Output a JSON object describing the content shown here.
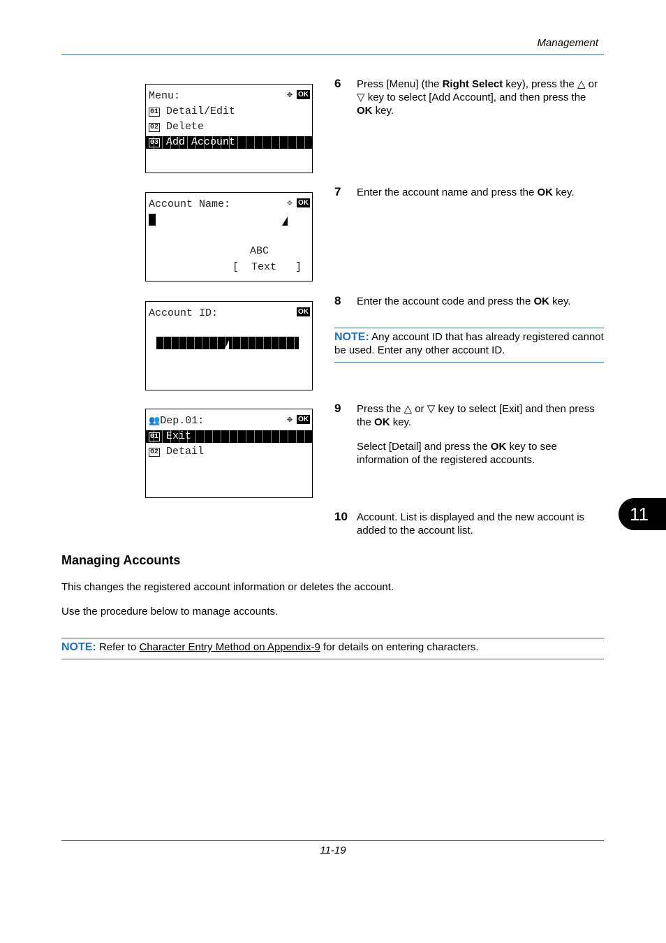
{
  "header": {
    "section": "Management"
  },
  "panels": [
    {
      "title": "Menu:",
      "nav_icon": "four-way-arrow",
      "ok": "OK",
      "items": [
        {
          "num": "01",
          "label": "Detail/Edit"
        },
        {
          "num": "02",
          "label": "Delete"
        },
        {
          "num": "03",
          "label": "Add Account",
          "selected": true
        }
      ]
    },
    {
      "title": "Account Name:",
      "nav_icon": "four-way-arrow-dotted",
      "ok": "OK",
      "mode": "ABC",
      "softkey": "[  Text   ]"
    },
    {
      "title": "Account ID:",
      "ok": "OK"
    },
    {
      "title": "Dep.01:",
      "title_icon": "group-icon",
      "nav_icon": "four-way-arrow",
      "ok": "OK",
      "items": [
        {
          "num": "01",
          "label": "Exit",
          "selected": true
        },
        {
          "num": "02",
          "label": "Detail"
        }
      ]
    }
  ],
  "steps": [
    {
      "num": "6",
      "parts": [
        "Press [Menu] (the ",
        "Right Select",
        " key), press the △ or ▽ key to select [Add Account], and then press the ",
        "OK",
        " key."
      ]
    },
    {
      "num": "7",
      "parts": [
        "Enter the account name and press the ",
        "OK",
        " key."
      ]
    },
    {
      "num": "8",
      "parts": [
        "Enter the account code and press the ",
        "OK",
        " key."
      ]
    },
    {
      "num": "9",
      "parts": [
        "Press the △ or ▽ key to select [Exit] and then press the ",
        "OK",
        " key."
      ],
      "extra": [
        "Select [Detail] and press the ",
        "OK",
        " key to see information of the registered accounts."
      ]
    },
    {
      "num": "10",
      "parts": [
        "Account. List is displayed and the new account is added to the account list."
      ]
    }
  ],
  "note1": {
    "label": "NOTE:",
    "text": " Any account ID that has already registered cannot be used. Enter any other account ID."
  },
  "section": {
    "heading": "Managing Accounts",
    "p1": "This changes the registered account information or deletes the account.",
    "p2": "Use the procedure below to manage accounts."
  },
  "note2": {
    "label": "NOTE:",
    "pre": " Refer to ",
    "link": "Character Entry Method on Appendix-9",
    "post": " for details on entering characters."
  },
  "chapter_tab": "11",
  "footer": {
    "page": "11-19"
  },
  "colors": {
    "accent": "#1a6fd0"
  }
}
